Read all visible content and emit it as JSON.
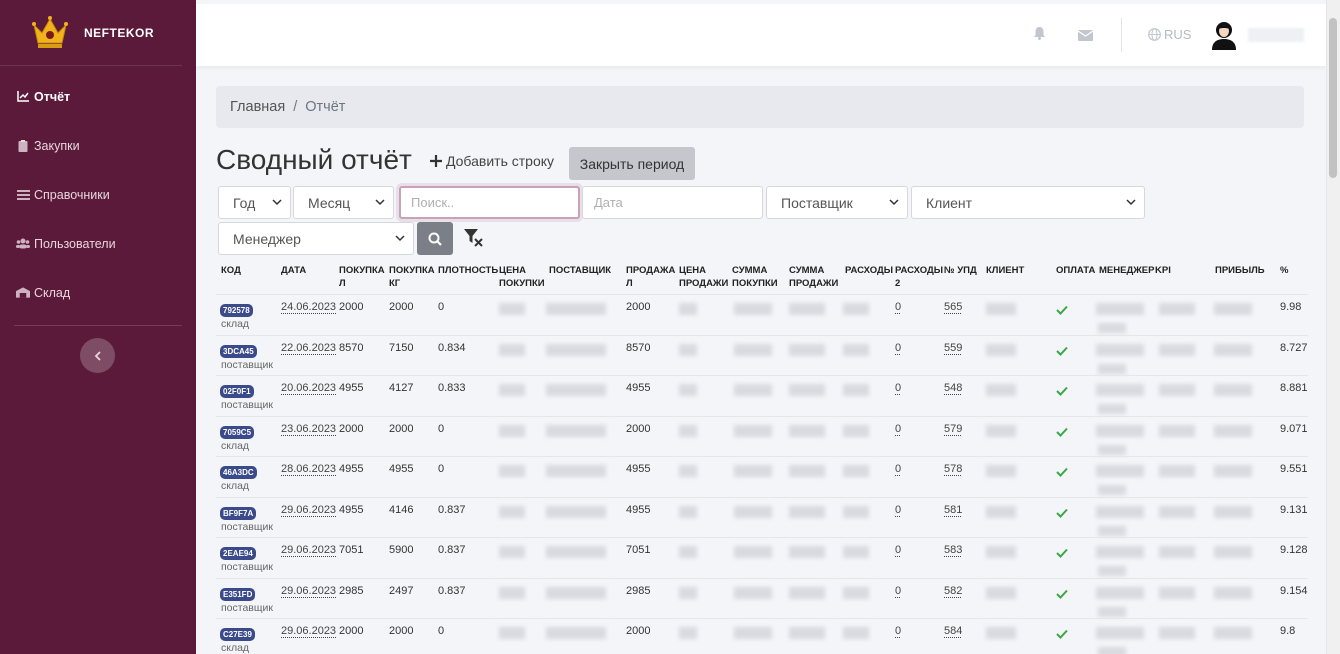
{
  "brand": {
    "name": "NEFTEKOR"
  },
  "sidebar": {
    "items": [
      {
        "label": "Отчёт",
        "icon": "chart-line-icon",
        "active": true
      },
      {
        "label": "Закупки",
        "icon": "clipboard-icon",
        "active": false
      },
      {
        "label": "Справочники",
        "icon": "list-icon",
        "active": false
      },
      {
        "label": "Пользователи",
        "icon": "users-icon",
        "active": false
      },
      {
        "label": "Склад",
        "icon": "warehouse-icon",
        "active": false
      }
    ]
  },
  "topbar": {
    "language": "RUS"
  },
  "breadcrumb": {
    "home": "Главная",
    "current": "Отчёт"
  },
  "page": {
    "title": "Сводный отчёт",
    "add_row_label": "Добавить строку",
    "close_period_label": "Закрыть период"
  },
  "filters": {
    "year": "Год",
    "month": "Месяц",
    "search_placeholder": "Поиск..",
    "date_placeholder": "Дата",
    "supplier": "Поставщик",
    "client": "Клиент",
    "manager": "Менеджер"
  },
  "table": {
    "headers": {
      "code": "КОД",
      "date": "ДАТА",
      "buy_l": "ПОКУПКА Л",
      "buy_kg": "ПОКУПКА КГ",
      "density": "ПЛОТНОСТЬ",
      "buy_price": "ЦЕНА ПОКУПКИ",
      "supplier": "ПОСТАВЩИК",
      "sale_l": "ПРОДАЖА Л",
      "sale_price": "ЦЕНА ПРОДАЖИ",
      "buy_sum": "СУММА ПОКУПКИ",
      "sale_sum": "СУММА ПРОДАЖИ",
      "expenses": "РАСХОДЫ",
      "expenses2": "РАСХОДЫ 2",
      "upd": "№ УПД",
      "client": "КЛИЕНТ",
      "payment": "ОПЛАТА",
      "manager": "МЕНЕДЖЕР",
      "kpi": "KPI",
      "profit": "ПРИБЫЛЬ",
      "pct": "%"
    },
    "rows": [
      {
        "code": "792578",
        "src": "склад",
        "date": "24.06.2023",
        "buy_l": "2000",
        "buy_kg": "2000",
        "density": "0",
        "sale_l": "2000",
        "exp2": "0",
        "upd": "565",
        "pct": "9.98"
      },
      {
        "code": "3DCA45",
        "src": "поставщик",
        "date": "22.06.2023",
        "buy_l": "8570",
        "buy_kg": "7150",
        "density": "0.834",
        "sale_l": "8570",
        "exp2": "0",
        "upd": "559",
        "pct": "8.727"
      },
      {
        "code": "02F0F1",
        "src": "поставщик",
        "date": "20.06.2023",
        "buy_l": "4955",
        "buy_kg": "4127",
        "density": "0.833",
        "sale_l": "4955",
        "exp2": "0",
        "upd": "548",
        "pct": "8.881"
      },
      {
        "code": "7059C5",
        "src": "склад",
        "date": "23.06.2023",
        "buy_l": "2000",
        "buy_kg": "2000",
        "density": "0",
        "sale_l": "2000",
        "exp2": "0",
        "upd": "579",
        "pct": "9.071"
      },
      {
        "code": "46A3DC",
        "src": "склад",
        "date": "28.06.2023",
        "buy_l": "4955",
        "buy_kg": "4955",
        "density": "0",
        "sale_l": "4955",
        "exp2": "0",
        "upd": "578",
        "pct": "9.551"
      },
      {
        "code": "BF9F7A",
        "src": "поставщик",
        "date": "29.06.2023",
        "buy_l": "4955",
        "buy_kg": "4146",
        "density": "0.837",
        "sale_l": "4955",
        "exp2": "0",
        "upd": "581",
        "pct": "9.131"
      },
      {
        "code": "2EAE94",
        "src": "поставщик",
        "date": "29.06.2023",
        "buy_l": "7051",
        "buy_kg": "5900",
        "density": "0.837",
        "sale_l": "7051",
        "exp2": "0",
        "upd": "583",
        "pct": "9.128"
      },
      {
        "code": "E351FD",
        "src": "поставщик",
        "date": "29.06.2023",
        "buy_l": "2985",
        "buy_kg": "2497",
        "density": "0.837",
        "sale_l": "2985",
        "exp2": "0",
        "upd": "582",
        "pct": "9.154"
      },
      {
        "code": "C27E39",
        "src": "склад",
        "date": "29.06.2023",
        "buy_l": "2000",
        "buy_kg": "2000",
        "density": "0",
        "sale_l": "2000",
        "exp2": "0",
        "upd": "584",
        "pct": "9.8"
      }
    ]
  },
  "colors": {
    "sidebar": "#5b1a3a",
    "badge": "#3a4a8a",
    "check": "#3aa845",
    "search_focus": "#c9a1b9"
  }
}
